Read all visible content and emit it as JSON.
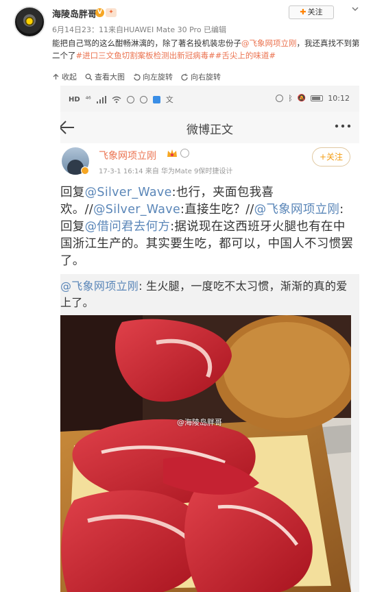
{
  "post": {
    "username": "海陵岛胖哥",
    "verified_badge": "V",
    "medal_icon": "medal-icon",
    "meta": "6月14日23：11来自HUAWEI Mate 30 Pro  已编辑",
    "follow_label": "关注",
    "follow_plus": "✚",
    "text_plain_1": "能把自己骂的这么酣畅淋漓的，除了著名投机装忠份子",
    "text_mention": "@飞象网项立刚",
    "text_plain_2": "，我还真找不到第二个了",
    "text_tags": "#进口三文鱼切割案板检测出新冠病毒##舌尖上的味道#"
  },
  "toolbar": {
    "collapse": "收起",
    "view_large": "查看大图",
    "rotate_left": "向左旋转",
    "rotate_right": "向右旋转"
  },
  "screenshot": {
    "status_left": "HD",
    "status_signal": "⁴⁶",
    "status_time": "10:12",
    "nav_title": "微博正文",
    "inner_name": "飞象网项立刚",
    "inner_meta": "17-3-1 16:14  来自 华为Mate 9保时捷设计",
    "inner_follow": "+关注",
    "reply": {
      "p1": "回复",
      "m1": "@Silver_Wave",
      "p2": ":也行，夹面包我喜欢。//",
      "m2": "@Silver_Wave",
      "p3": ":直接生吃？//",
      "m3": "@飞象网项立刚",
      "p4": ":回复",
      "m4": "@借问君去何方",
      "p5": ":据说现在这西班牙火腿也有在中国浙江生产的。其实要生吃，都可以，中国人不习惯罢了。"
    },
    "quote": {
      "mention": "@飞象网项立刚",
      "text": ": 生火腿，一度吃不太习惯，渐渐的真的爱上了。"
    },
    "watermark": "@海陵岛胖哥"
  },
  "colors": {
    "link_orange": "#eb7350",
    "link_blue": "#5a86b8",
    "accent": "#ff8200"
  }
}
